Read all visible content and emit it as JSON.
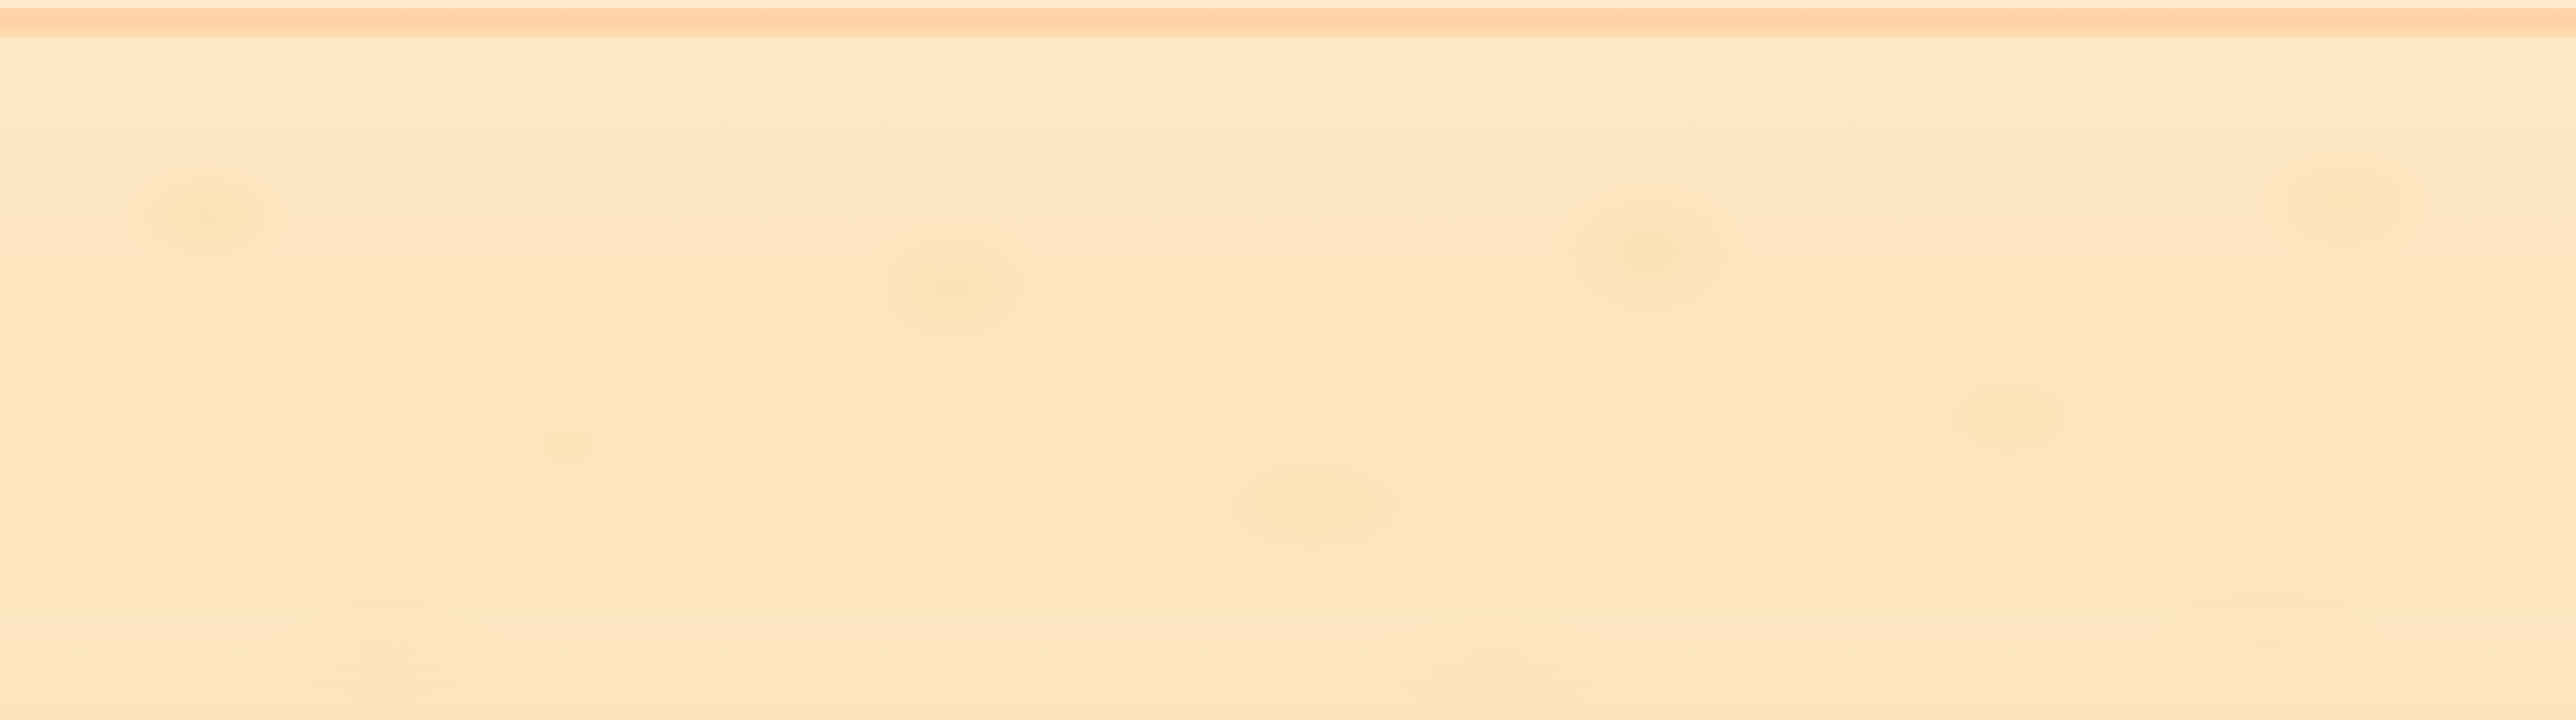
{
  "page": {
    "background_color": "#fde6c0",
    "band_color": "#ffd2a5"
  }
}
